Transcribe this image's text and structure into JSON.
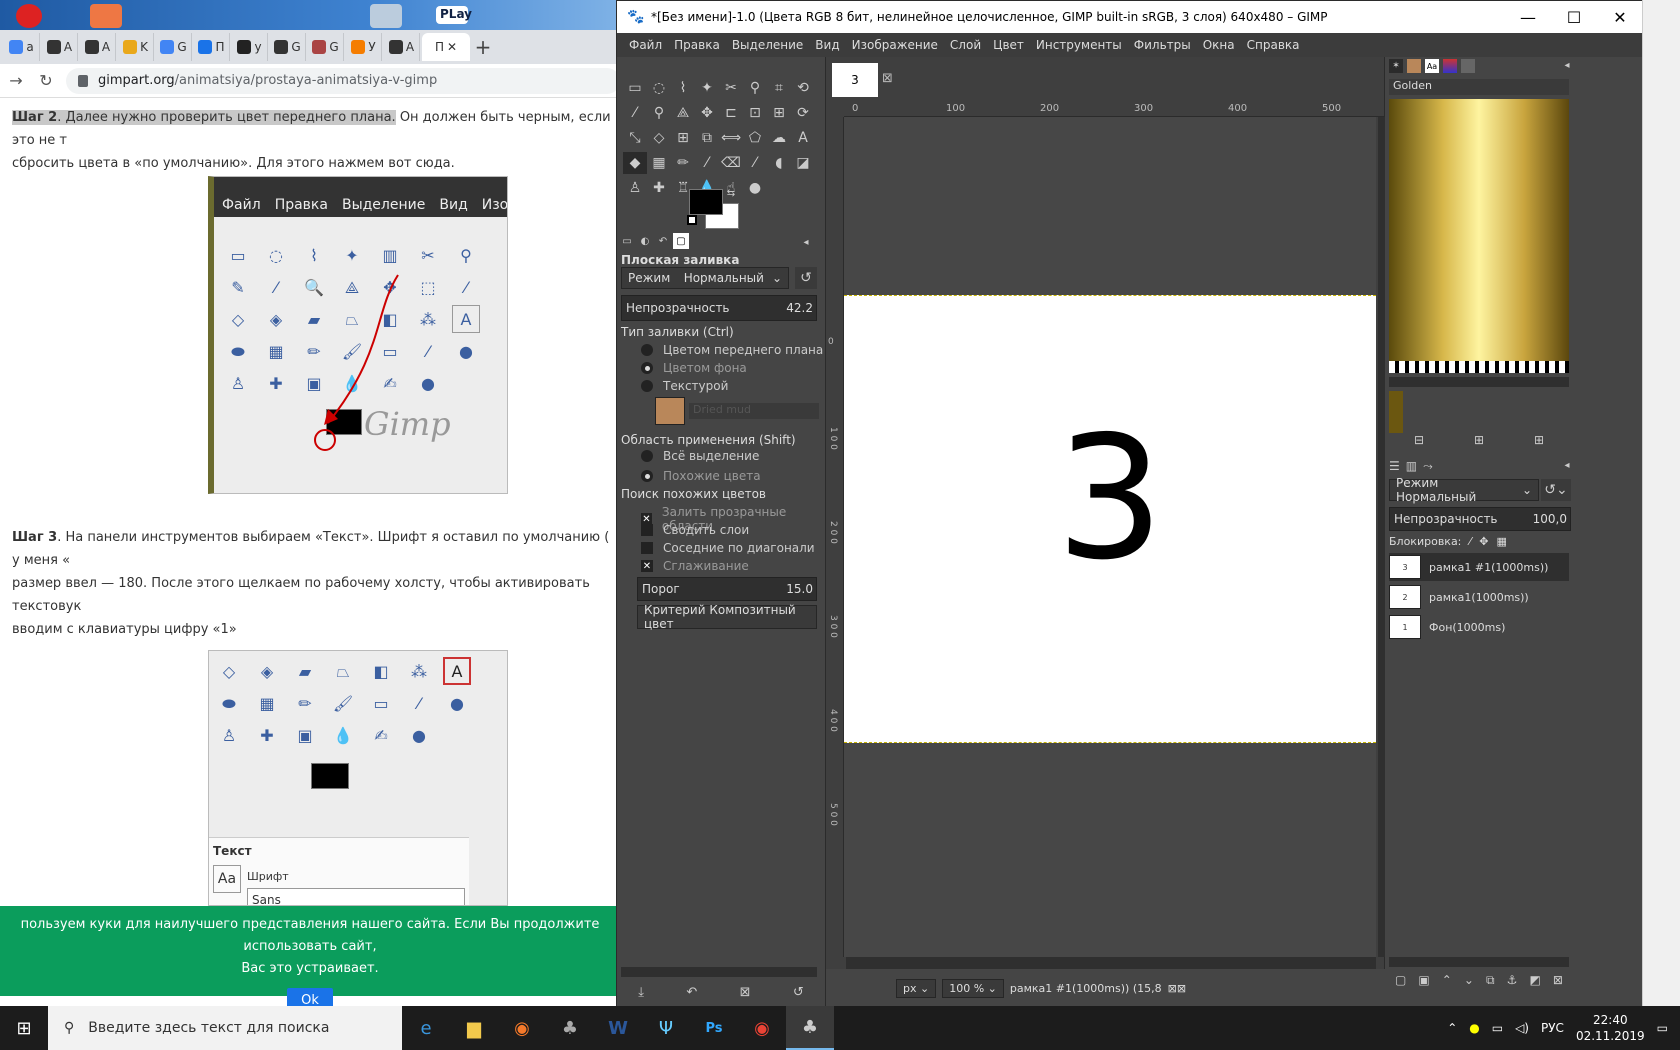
{
  "browser": {
    "tabs": [
      "a",
      "A",
      "A",
      "K",
      "G",
      "П",
      "у",
      "G",
      "G",
      "У",
      "A",
      "П"
    ],
    "active_tab_label": "П",
    "new_tab": "+",
    "url_host": "gimpart.org",
    "url_path": "/animatsiya/prostaya-animatsiya-v-gimp",
    "desktop_play": "PLay"
  },
  "article": {
    "step2_bold": "Шаг 2",
    "step2_hl": ". Далее нужно проверить цвет переднего плана.",
    "step2_rest": " Он должен быть черным, если это не т",
    "step2_line2": "сбросить цвета в «по умолчанию». Для этого нажмем вот сюда.",
    "shot1_menu": [
      "Файл",
      "Правка",
      "Выделение",
      "Вид",
      "Изоб"
    ],
    "step3_bold": "Шаг 3",
    "step3_line1": ". На панели инструментов выбираем «Текст». Шрифт я оставил по умолчанию ( у меня «",
    "step3_line2": "размер ввел — 180. После этого щелкаем по рабочему холсту, чтобы активировать текстовук",
    "step3_line3": "вводим с клавиатуры цифру «1»",
    "shot2_text_label": "Текст",
    "shot2_font_label": "Шрифт",
    "shot2_font_value": "Sans",
    "shot2_aa": "Aa"
  },
  "cookie": {
    "line1": "пользуем куки для наилучшего представления нашего сайта. Если Вы продолжите использовать сайт,",
    "line2": "Вас это устраивает.",
    "ok": "Ok"
  },
  "gimp": {
    "title": "*[Без имени]-1.0 (Цвета RGB 8 бит, нелинейное целочисленное, GIMP built-in sRGB, 3 слоя) 640x480 – GIMP",
    "menu": [
      "Файл",
      "Правка",
      "Выделение",
      "Вид",
      "Изображение",
      "Слой",
      "Цвет",
      "Инструменты",
      "Фильтры",
      "Окна",
      "Справка"
    ],
    "tool_options": {
      "title": "Плоская заливка",
      "mode_label": "Режим",
      "mode_value": "Нормальный",
      "opacity_label": "Непрозрачность",
      "opacity_value": "42.2",
      "fill_type_label": "Тип заливки (Ctrl)",
      "fill_fg": "Цветом переднего плана",
      "fill_bg": "Цветом фона",
      "fill_pattern": "Текстурой",
      "pattern_name": "Dried mud",
      "area_label": "Область применения (Shift)",
      "area_all": "Всё выделение",
      "area_similar": "Похожие цвета",
      "similar_label": "Поиск похожих цветов",
      "chk_transparent": "Залить прозрачные области",
      "chk_merge": "Сводить слои",
      "chk_diagonal": "Соседние по диагонали",
      "chk_antialias": "Сглаживание",
      "threshold_label": "Порог",
      "threshold_value": "15.0",
      "criterion": "Критерий Композитный цвет"
    },
    "image_tab": "3",
    "canvas_text": "3",
    "ruler_labels": [
      "0",
      "100",
      "200",
      "300",
      "400",
      "500"
    ],
    "vruler_labels": [
      "0",
      "1 0 0",
      "2 0 0",
      "3 0 0",
      "4 0 0",
      "5 0 0"
    ],
    "status": {
      "unit": "px",
      "zoom": "100 %",
      "layer_info": "рамка1 #1(1000ms)) (15,8"
    },
    "gradient_name": "Golden",
    "layers_mode": "Режим Нормальный",
    "layers_opacity_label": "Непрозрачность",
    "layers_opacity_value": "100,0",
    "lock_label": "Блокировка:",
    "layers": [
      {
        "num": "3",
        "name": "рамка1 #1(1000ms))"
      },
      {
        "num": "2",
        "name": "рамка1(1000ms))"
      },
      {
        "num": "1",
        "name": "Фон(1000ms)"
      }
    ]
  },
  "taskbar": {
    "search_placeholder": "Введите здесь текст для поиска",
    "lang": "РУС",
    "time": "22:40",
    "date": "02.11.2019"
  },
  "colors": {
    "gimp_bg": "#454545",
    "cookie_bg": "#0b9d5c",
    "ok_btn": "#1a73e8"
  }
}
